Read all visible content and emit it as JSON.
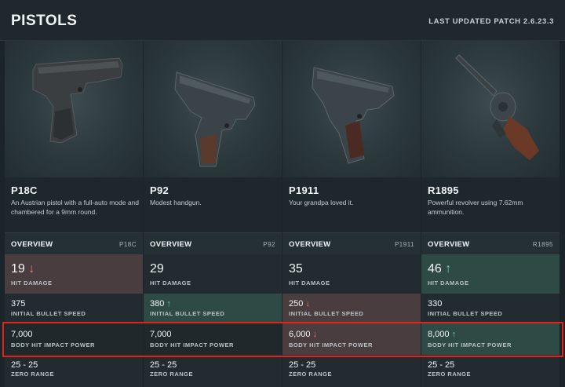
{
  "header": {
    "title": "PISTOLS",
    "patch": "LAST UPDATED PATCH 2.6.23.3"
  },
  "colors": {
    "better": "#2e4a44",
    "worse": "#4a3d3f",
    "up_arrow": "#6fd39b",
    "down_arrow": "#e57d6f",
    "highlight": "#e32219"
  },
  "weapons": [
    {
      "name": "P18C",
      "desc": "An Austrian pistol with a full-auto mode and chambered for a 9mm round.",
      "overview": "OVERVIEW",
      "tag": "P18C",
      "icon": "p18c-pistol-image",
      "hit_damage": "19",
      "hit_damage_arrow": "↓",
      "hit_damage_label": "HIT DAMAGE",
      "speed": "375",
      "speed_arrow": "",
      "speed_label": "INITIAL BULLET SPEED",
      "impact": "7,000",
      "impact_arrow": "",
      "impact_label": "BODY HIT IMPACT POWER",
      "zero": "25 - 25",
      "zero_label": "ZERO RANGE"
    },
    {
      "name": "P92",
      "desc": "Modest handgun.",
      "overview": "OVERVIEW",
      "tag": "P92",
      "icon": "p92-pistol-image",
      "hit_damage": "29",
      "hit_damage_arrow": "",
      "hit_damage_label": "HIT DAMAGE",
      "speed": "380",
      "speed_arrow": "↑",
      "speed_label": "INITIAL BULLET SPEED",
      "impact": "7,000",
      "impact_arrow": "",
      "impact_label": "BODY HIT IMPACT POWER",
      "zero": "25 - 25",
      "zero_label": "ZERO RANGE"
    },
    {
      "name": "P1911",
      "desc": "Your grandpa loved it.",
      "overview": "OVERVIEW",
      "tag": "P1911",
      "icon": "p1911-pistol-image",
      "hit_damage": "35",
      "hit_damage_arrow": "",
      "hit_damage_label": "HIT DAMAGE",
      "speed": "250",
      "speed_arrow": "↓",
      "speed_label": "INITIAL BULLET SPEED",
      "impact": "6,000",
      "impact_arrow": "↓",
      "impact_label": "BODY HIT IMPACT POWER",
      "zero": "25 - 25",
      "zero_label": "ZERO RANGE"
    },
    {
      "name": "R1895",
      "desc": "Powerful revolver using 7.62mm ammunition.",
      "overview": "OVERVIEW",
      "tag": "R1895",
      "icon": "r1895-revolver-image",
      "hit_damage": "46",
      "hit_damage_arrow": "↑",
      "hit_damage_label": "HIT DAMAGE",
      "speed": "330",
      "speed_arrow": "",
      "speed_label": "INITIAL BULLET SPEED",
      "impact": "8,000",
      "impact_arrow": "↑",
      "impact_label": "BODY HIT IMPACT POWER",
      "zero": "25 - 25",
      "zero_label": "ZERO RANGE"
    }
  ]
}
